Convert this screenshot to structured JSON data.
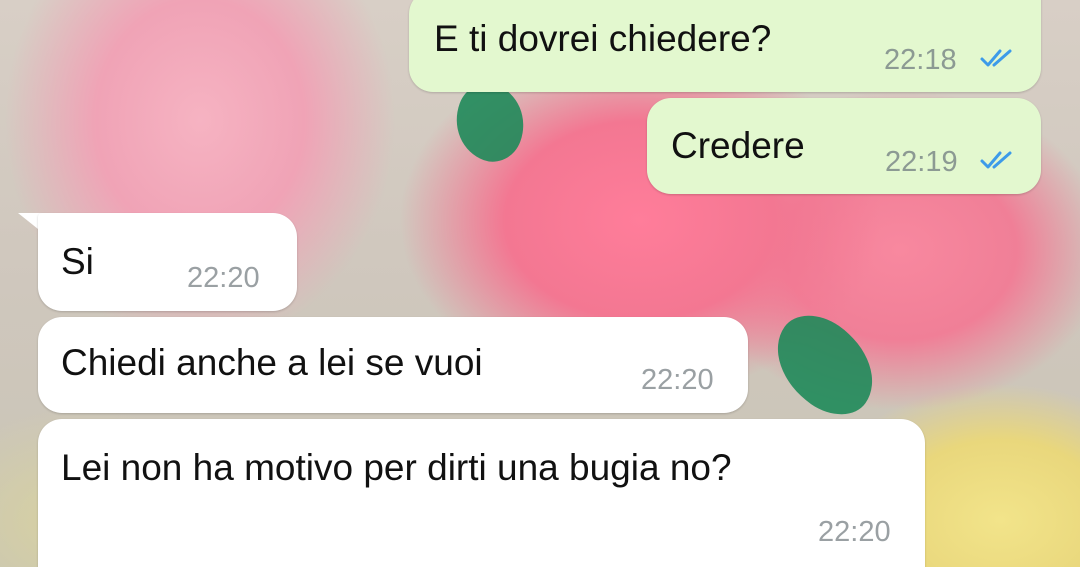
{
  "messages": [
    {
      "direction": "outgoing",
      "text": "E ti dovrei chiedere?",
      "time": "22:18",
      "status": "read",
      "status_icon": "double-check-icon",
      "status_color": "#3d9be9"
    },
    {
      "direction": "outgoing",
      "text": "Credere",
      "time": "22:19",
      "status": "read",
      "status_icon": "double-check-icon",
      "status_color": "#3d9be9"
    },
    {
      "direction": "incoming",
      "text": "Si",
      "time": "22:20"
    },
    {
      "direction": "incoming",
      "text": "Chiedi anche a lei se vuoi",
      "time": "22:20"
    },
    {
      "direction": "incoming",
      "text": "Lei non ha motivo per dirti una bugia no?",
      "time": "22:20"
    }
  ],
  "colors": {
    "outgoing_bubble": "#e3f8cf",
    "incoming_bubble": "#ffffff",
    "read_ticks": "#3d9be9"
  }
}
